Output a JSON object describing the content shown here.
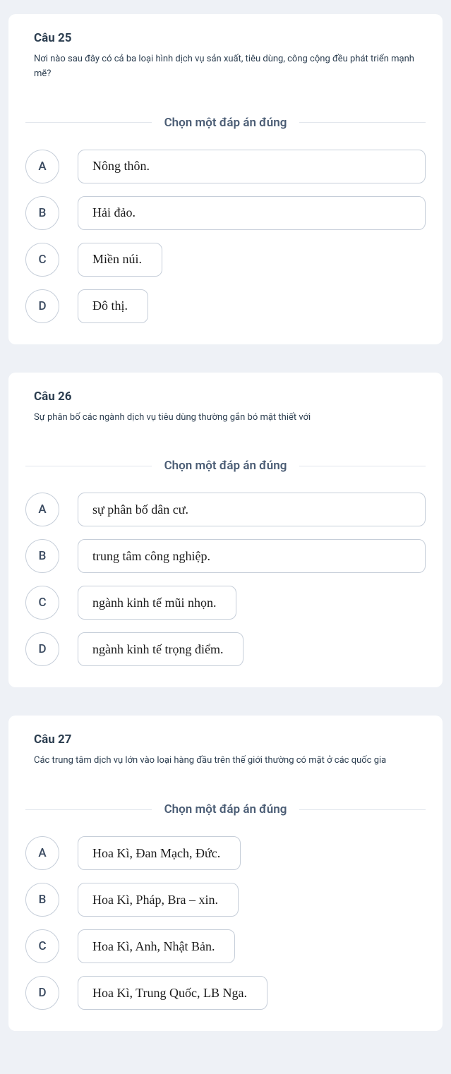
{
  "instruction": "Chọn một đáp án đúng",
  "questions": [
    {
      "title": "Câu 25",
      "body": "Nơi nào sau đây có cả ba loại hình dịch vụ sản xuất, tiêu dùng, công cộng đều phát triển mạnh mẽ?",
      "options": [
        {
          "letter": "A",
          "text": "Nông thôn.",
          "short": false
        },
        {
          "letter": "B",
          "text": "Hải đảo.",
          "short": false
        },
        {
          "letter": "C",
          "text": "Miền núi.",
          "short": true
        },
        {
          "letter": "D",
          "text": "Đô thị.",
          "short": true
        }
      ]
    },
    {
      "title": "Câu 26",
      "body": "Sự phân bố các ngành dịch vụ tiêu dùng thường gắn bó mật thiết với",
      "options": [
        {
          "letter": "A",
          "text": "sự phân bố dân cư.",
          "short": false
        },
        {
          "letter": "B",
          "text": "trung tâm công nghiệp.",
          "short": false
        },
        {
          "letter": "C",
          "text": "ngành kinh tế mũi nhọn.",
          "short": true
        },
        {
          "letter": "D",
          "text": "ngành kinh tế trọng điểm.",
          "short": true
        }
      ]
    },
    {
      "title": "Câu 27",
      "body": "Các trung tâm dịch vụ lớn vào loại hàng đầu trên thế giới thường có mặt ở các quốc gia",
      "options": [
        {
          "letter": "A",
          "text": "Hoa Kì, Đan Mạch, Đức.",
          "short": true
        },
        {
          "letter": "B",
          "text": "Hoa Kì, Pháp, Bra – xin.",
          "short": true
        },
        {
          "letter": "C",
          "text": "Hoa Kì, Anh, Nhật Bản.",
          "short": true
        },
        {
          "letter": "D",
          "text": "Hoa Kì, Trung Quốc, LB Nga.",
          "short": true
        }
      ]
    }
  ]
}
